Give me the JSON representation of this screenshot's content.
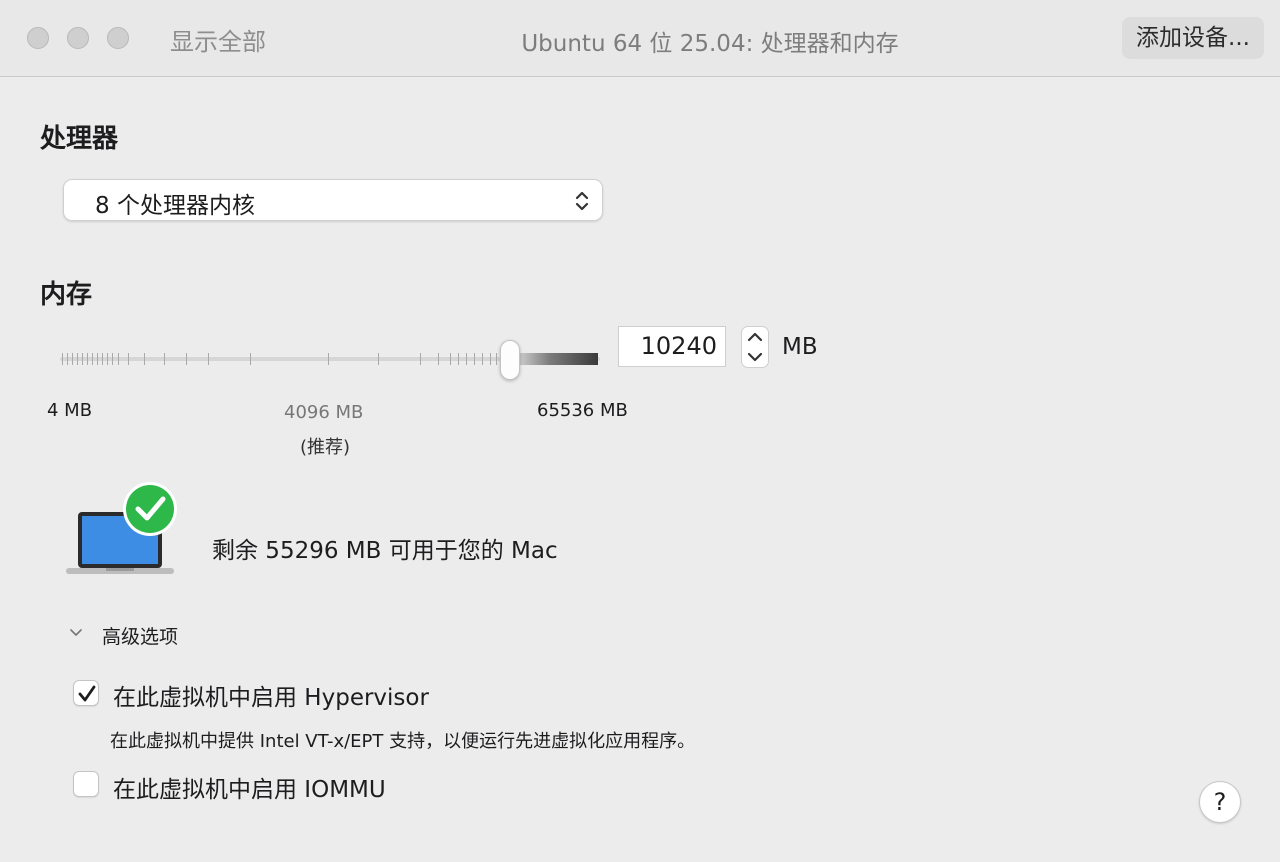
{
  "window": {
    "show_all": "显示全部",
    "title": "Ubuntu 64 位 25.04: 处理器和内存",
    "add_device": "添加设备..."
  },
  "processor": {
    "title": "处理器",
    "selected": "8 个处理器内核"
  },
  "memory": {
    "title": "内存",
    "value": "10240",
    "unit": "MB",
    "slider_min": "4 MB",
    "slider_recommended": "4096 MB",
    "slider_recommended_note": "(推荐)",
    "slider_max": "65536 MB",
    "slider_value_fraction": 0.83,
    "available": "剩余 55296 MB 可用于您的 Mac"
  },
  "advanced": {
    "label": "高级选项",
    "expanded": true,
    "hypervisor": {
      "label": "在此虚拟机中启用 Hypervisor",
      "checked": true,
      "description": "在此虚拟机中提供 Intel VT-x/EPT 支持，以便运行先进虚拟化应用程序。"
    },
    "iommu": {
      "label": "在此虚拟机中启用 IOMMU",
      "checked": false
    }
  },
  "help": {
    "label": "?"
  },
  "icons": {
    "close": "close-dot-icon",
    "minimize": "minimize-dot-icon",
    "zoom": "zoom-dot-icon",
    "select_arrows": "up-down-chevron-icon",
    "stepper": "stepper-icon",
    "laptop": "laptop-icon",
    "check_badge": "green-checkmark-icon",
    "disclosure": "chevron-down-icon",
    "checkmark": "checkmark-icon"
  },
  "colors": {
    "check_badge": "#2fb84a",
    "laptop_screen": "#3c8de3"
  }
}
